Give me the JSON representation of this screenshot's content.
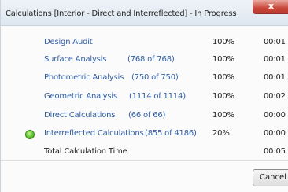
{
  "window": {
    "title": "Calculations [Interior - Direct and Interreflected] - In Progress",
    "close_label": "x"
  },
  "rows": [
    {
      "task": "Design Audit",
      "count": "",
      "percent": "100%",
      "time": "00:01"
    },
    {
      "task": "Surface Analysis",
      "count": "(768 of 768)",
      "percent": "100%",
      "time": "00:01"
    },
    {
      "task": "Photometric Analysis",
      "count": "(750 of 750)",
      "percent": "100%",
      "time": "00:01"
    },
    {
      "task": "Geometric Analysis",
      "count": "(1114 of 1114)",
      "percent": "100%",
      "time": "00:02"
    },
    {
      "task": "Direct Calculations",
      "count": "(66 of 66)",
      "percent": "100%",
      "time": "00:00"
    },
    {
      "task": "Interreflected Calculations",
      "count": "(855 of 4186)",
      "percent": "20%",
      "time": "00:00",
      "status_icon": "green-status-icon"
    }
  ],
  "total": {
    "label": "Total Calculation Time",
    "time": "00:05"
  },
  "buttons": {
    "cancel": "Cancel"
  },
  "colors": {
    "link": "#2f5ea6",
    "status": "#6fce39",
    "close": "#c9473b"
  }
}
